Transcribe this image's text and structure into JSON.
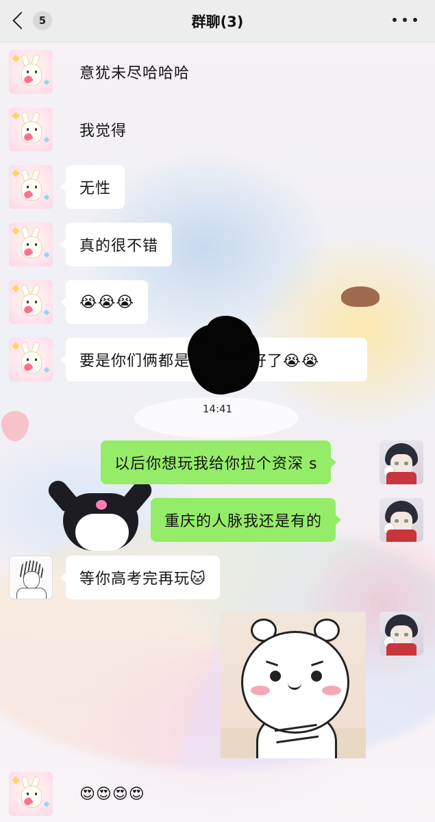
{
  "header": {
    "back_count": "5",
    "title": "群聊(3)"
  },
  "messages": {
    "m1": {
      "text": "意犹未尽哈哈哈"
    },
    "m2": {
      "text": "我觉得"
    },
    "m3": {
      "text": "无性"
    },
    "m4": {
      "text": "真的很不错"
    },
    "m5": {
      "text": "😭😭😭"
    },
    "m6": {
      "text_before": "要是你们俩都是",
      "text_after": "的就好了😭😭"
    },
    "time": "14:41",
    "m7": {
      "text": "以后你想玩我给你拉个资深 s"
    },
    "m8": {
      "text": "重庆的人脉我还是有的"
    },
    "m9": {
      "text": "等你高考完再玩🐱"
    },
    "m11": {
      "text": "😍😍😍😍"
    }
  },
  "icons": {
    "back": "chevron-left-icon",
    "more": "more-dots-icon"
  },
  "colors": {
    "header_bg": "#ededed",
    "incoming_bubble": "#ffffff",
    "outgoing_bubble": "#95ec69"
  }
}
